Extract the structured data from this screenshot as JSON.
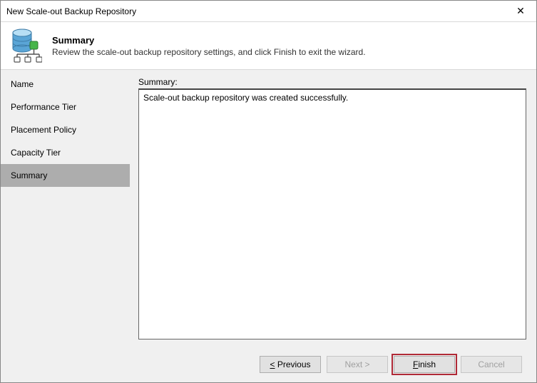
{
  "window": {
    "title": "New Scale-out Backup Repository"
  },
  "banner": {
    "title": "Summary",
    "description": "Review the scale-out backup repository settings, and click Finish to exit the wizard."
  },
  "sidebar": {
    "items": [
      {
        "label": "Name"
      },
      {
        "label": "Performance Tier"
      },
      {
        "label": "Placement Policy"
      },
      {
        "label": "Capacity Tier"
      },
      {
        "label": "Summary"
      }
    ],
    "selected_index": 4
  },
  "content": {
    "summary_label": "Summary:",
    "summary_text": "Scale-out backup repository was created successfully."
  },
  "footer": {
    "previous": "< Previous",
    "next": "Next >",
    "finish": "Finish",
    "cancel": "Cancel"
  }
}
